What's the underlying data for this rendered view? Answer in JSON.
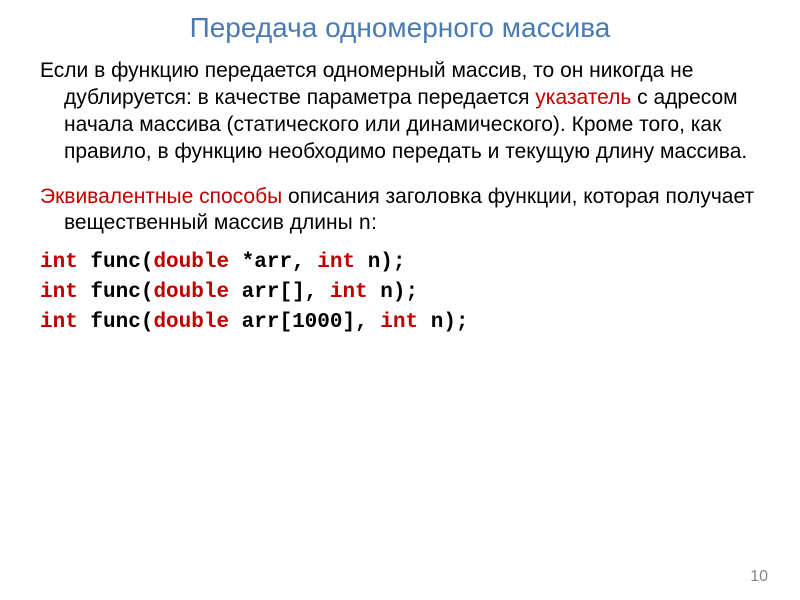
{
  "title": "Передача одномерного массива",
  "para1_a": "Если в функцию передается одномерный массив, то он никогда не дублируется: в качестве параметра передается ",
  "para1_hl": "указатель",
  "para1_b": " с адресом начала массива (статического или динамического). Кроме того, как правило, в функцию необходимо передать и текущую длину массива.",
  "para2_a": "Эквивалентные способы",
  "para2_b": " описания заголовка функции, которая получает вещественный массив  длины ",
  "para2_n": "n",
  "para2_c": ":",
  "code1_a": "int",
  "code1_b": " func(",
  "code1_c": "double",
  "code1_d": " *arr, ",
  "code1_e": "int",
  "code1_f": " n);",
  "code2_a": "int",
  "code2_b": " func(",
  "code2_c": "double",
  "code2_d": " arr[], ",
  "code2_e": "int",
  "code2_f": " n);",
  "code3_a": "int",
  "code3_b": " func(",
  "code3_c": "double",
  "code3_d": " arr[1000], ",
  "code3_e": "int",
  "code3_f": " n);",
  "page_num": "10"
}
